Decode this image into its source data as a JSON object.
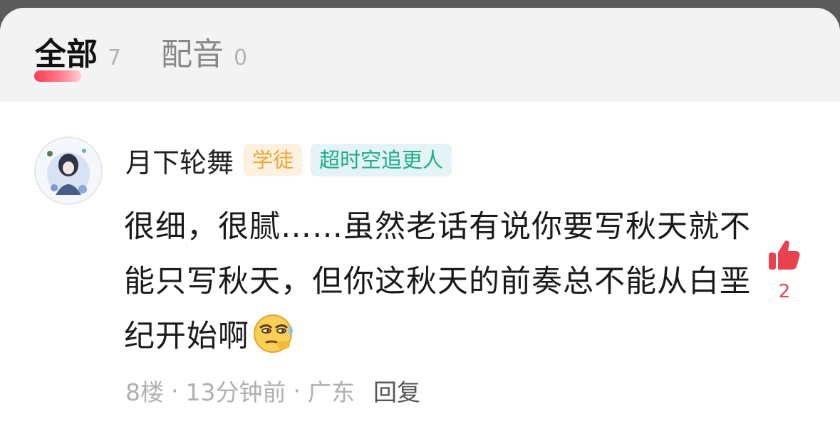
{
  "tabs": {
    "all": {
      "label": "全部",
      "count": "7"
    },
    "dub": {
      "label": "配音",
      "count": "0"
    }
  },
  "comment": {
    "username": "月下轮舞",
    "badges": [
      "学徒",
      "超时空追更人"
    ],
    "text": "很细，很腻……虽然老话有说你要写秋天就不能只写秋天，但你这秋天的前奏总不能从白垩纪开始啊",
    "emoji_icon": "sweat-smug-emoji-icon",
    "like_count": "2",
    "floor": "8楼",
    "time": "13分钟前",
    "location": "广东",
    "reply_label": "回复"
  },
  "colors": {
    "accent": "#e8414f",
    "badge_apprentice": "#f0a733",
    "badge_title": "#1fae8a"
  }
}
